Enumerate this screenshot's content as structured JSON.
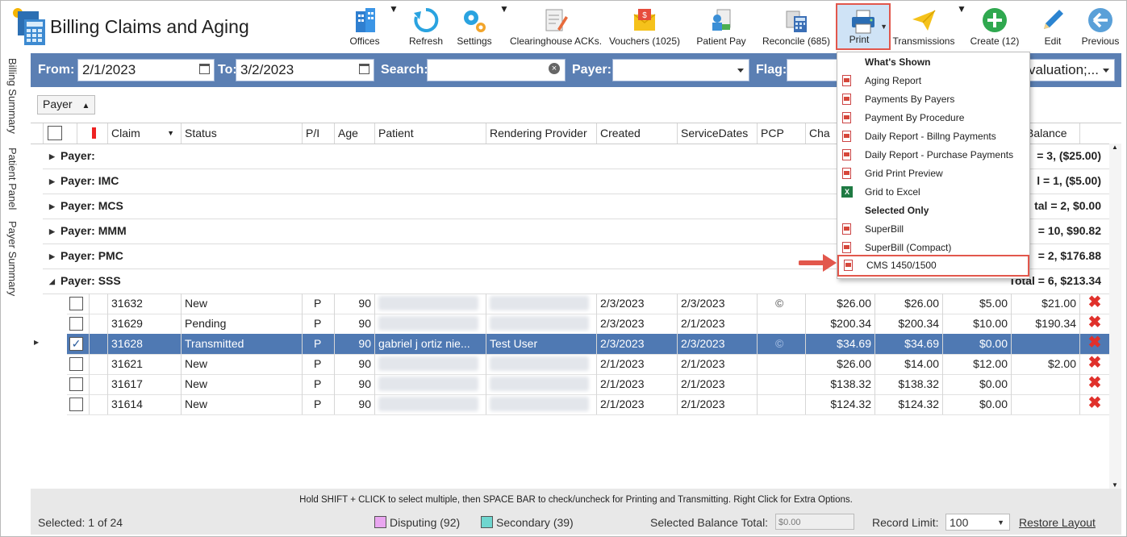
{
  "app": {
    "title": "Billing Claims and Aging"
  },
  "toolbar": [
    {
      "id": "offices",
      "label": "Offices",
      "icon": "buildings-icon"
    },
    {
      "id": "refresh",
      "label": "Refresh",
      "icon": "refresh-icon"
    },
    {
      "id": "settings",
      "label": "Settings",
      "icon": "gears-icon"
    },
    {
      "id": "clearinghouse",
      "label": "Clearinghouse ACKs.",
      "icon": "document-edit-icon"
    },
    {
      "id": "vouchers",
      "label": "Vouchers (1025)",
      "icon": "envelope-money-icon"
    },
    {
      "id": "patientpay",
      "label": "Patient Pay",
      "icon": "patient-pay-icon"
    },
    {
      "id": "reconcile",
      "label": "Reconcile (685)",
      "icon": "calculator-icon"
    },
    {
      "id": "print",
      "label": "Print",
      "icon": "printer-icon"
    },
    {
      "id": "transmissions",
      "label": "Transmissions",
      "icon": "paper-plane-icon"
    },
    {
      "id": "create",
      "label": "Create (12)",
      "icon": "plus-circle-icon"
    },
    {
      "id": "edit",
      "label": "Edit",
      "icon": "pencil-icon"
    },
    {
      "id": "previous",
      "label": "Previous",
      "icon": "back-arrow-icon"
    }
  ],
  "side_tabs": [
    "Billing Summary",
    "Patient Panel",
    "Payer Summary"
  ],
  "filters": {
    "from_label": "From:",
    "from_value": "2/1/2023",
    "to_label": "To:",
    "to_value": "3/2/2023",
    "search_label": "Search:",
    "search_value": "",
    "payer_label": "Payer:",
    "payer_value": "",
    "flag_label": "Flag:",
    "extra_value": "valuation;..."
  },
  "group_by": "Payer",
  "columns": [
    "Claim",
    "Status",
    "P/I",
    "Age",
    "Patient",
    "Rendering Provider",
    "Created",
    "ServiceDates",
    "PCP",
    "Cha",
    "Balance"
  ],
  "groups": [
    {
      "label": "Payer:",
      "total": "= 3,  ($25.00)"
    },
    {
      "label": "Payer: IMC",
      "total": "l = 1,  ($5.00)"
    },
    {
      "label": "Payer: MCS",
      "total": "tal = 2,  $0.00"
    },
    {
      "label": "Payer: MMM",
      "total": "= 10,  $90.82"
    },
    {
      "label": "Payer: PMC",
      "total": "= 2,  $176.88"
    },
    {
      "label": "Payer: SSS",
      "total": "Total = 6,  $213.34"
    }
  ],
  "rows": [
    {
      "claim": "31632",
      "status": "New",
      "pi": "P",
      "age": "90",
      "patient": "",
      "provider": "",
      "created": "2/3/2023",
      "service": "2/3/2023",
      "pcp": "©",
      "charge": "$26.00",
      "c2": "$26.00",
      "c3": "$5.00",
      "balance": "$21.00",
      "checked": false
    },
    {
      "claim": "31629",
      "status": "Pending",
      "pi": "P",
      "age": "90",
      "patient": "",
      "provider": "",
      "created": "2/3/2023",
      "service": "2/1/2023",
      "pcp": "",
      "charge": "$200.34",
      "c2": "$200.34",
      "c3": "$10.00",
      "balance": "$190.34",
      "checked": false
    },
    {
      "claim": "31628",
      "status": "Transmitted",
      "pi": "P",
      "age": "90",
      "patient": "gabriel j ortiz nie...",
      "provider": "Test User",
      "created": "2/3/2023",
      "service": "2/3/2023",
      "pcp": "©",
      "charge": "$34.69",
      "c2": "$34.69",
      "c3": "$0.00",
      "balance": "",
      "checked": true
    },
    {
      "claim": "31621",
      "status": "New",
      "pi": "P",
      "age": "90",
      "patient": "",
      "provider": "",
      "created": "2/1/2023",
      "service": "2/1/2023",
      "pcp": "",
      "charge": "$26.00",
      "c2": "$14.00",
      "c3": "$12.00",
      "balance": "$2.00",
      "checked": false
    },
    {
      "claim": "31617",
      "status": "New",
      "pi": "P",
      "age": "90",
      "patient": "",
      "provider": "",
      "created": "2/1/2023",
      "service": "2/1/2023",
      "pcp": "",
      "charge": "$138.32",
      "c2": "$138.32",
      "c3": "$0.00",
      "balance": "",
      "checked": false
    },
    {
      "claim": "31614",
      "status": "New",
      "pi": "P",
      "age": "90",
      "patient": "",
      "provider": "",
      "created": "2/1/2023",
      "service": "2/1/2023",
      "pcp": "",
      "charge": "$124.32",
      "c2": "$124.32",
      "c3": "$0.00",
      "balance": "",
      "checked": false
    }
  ],
  "print_menu": {
    "whats_shown": "What's Shown",
    "items_shown": [
      "Aging Report",
      "Payments By Payers",
      "Payment By Procedure",
      "Daily Report - Billng Payments",
      "Daily Report - Purchase Payments",
      "Grid Print Preview",
      "Grid to Excel"
    ],
    "selected_only": "Selected Only",
    "items_selected": [
      "SuperBill",
      "SuperBill (Compact)",
      "CMS 1450/1500"
    ]
  },
  "footer": {
    "hint": "Hold SHIFT + CLICK to select multiple, then SPACE BAR to check/uncheck for Printing and Transmitting. Right Click for Extra Options.",
    "selected": "Selected: 1 of 24",
    "disputing": "Disputing (92)",
    "secondary": "Secondary (39)",
    "balance_label": "Selected Balance Total:",
    "balance_value": "$0.00",
    "limit_label": "Record Limit:",
    "limit_value": "100",
    "restore": "Restore Layout"
  },
  "colors": {
    "accent": "#5b7fb3",
    "selected_row": "#4f79b3",
    "highlight": "#e2574c",
    "disputing": "#e9a6f0",
    "secondary": "#6fd6cf"
  }
}
